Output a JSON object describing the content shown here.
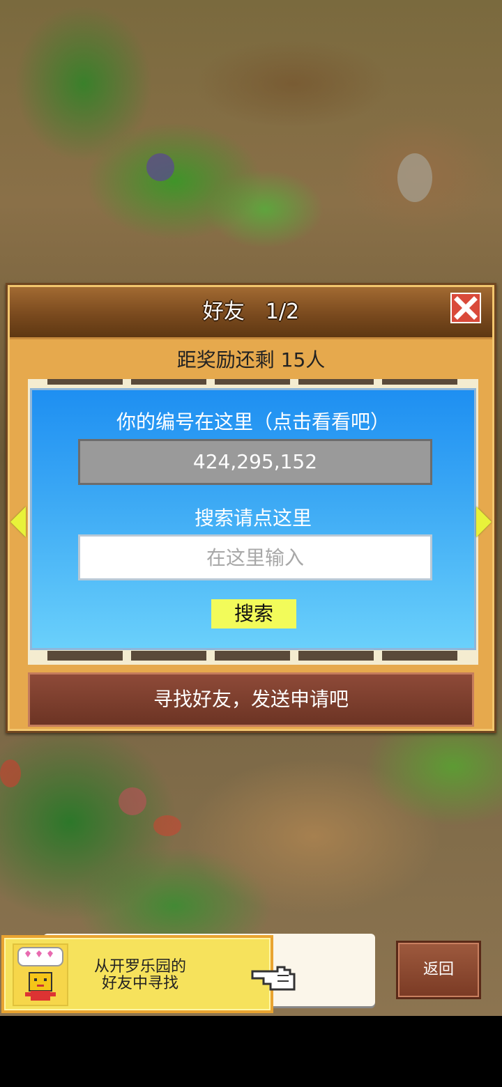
{
  "dialog": {
    "title": "好友　1/2",
    "reward_text": "距奖励还剩 15人",
    "id_caption": "你的编号在这里（点击看看吧）",
    "id_value": "424,295,152",
    "search_caption": "搜索请点这里",
    "search_placeholder": "在这里输入",
    "search_button": "搜索",
    "find_friends_button": "寻找好友，发送申请吧"
  },
  "banner": {
    "line1": "从开罗乐园的",
    "line2": "好友中寻找"
  },
  "back_button": "返回",
  "colors": {
    "panel_blue": "#1e8ff2",
    "search_button": "#f2fb5a",
    "close_button": "#d94a3a",
    "find_button": "#7a3e2c",
    "banner_yellow": "#f6e25c"
  }
}
